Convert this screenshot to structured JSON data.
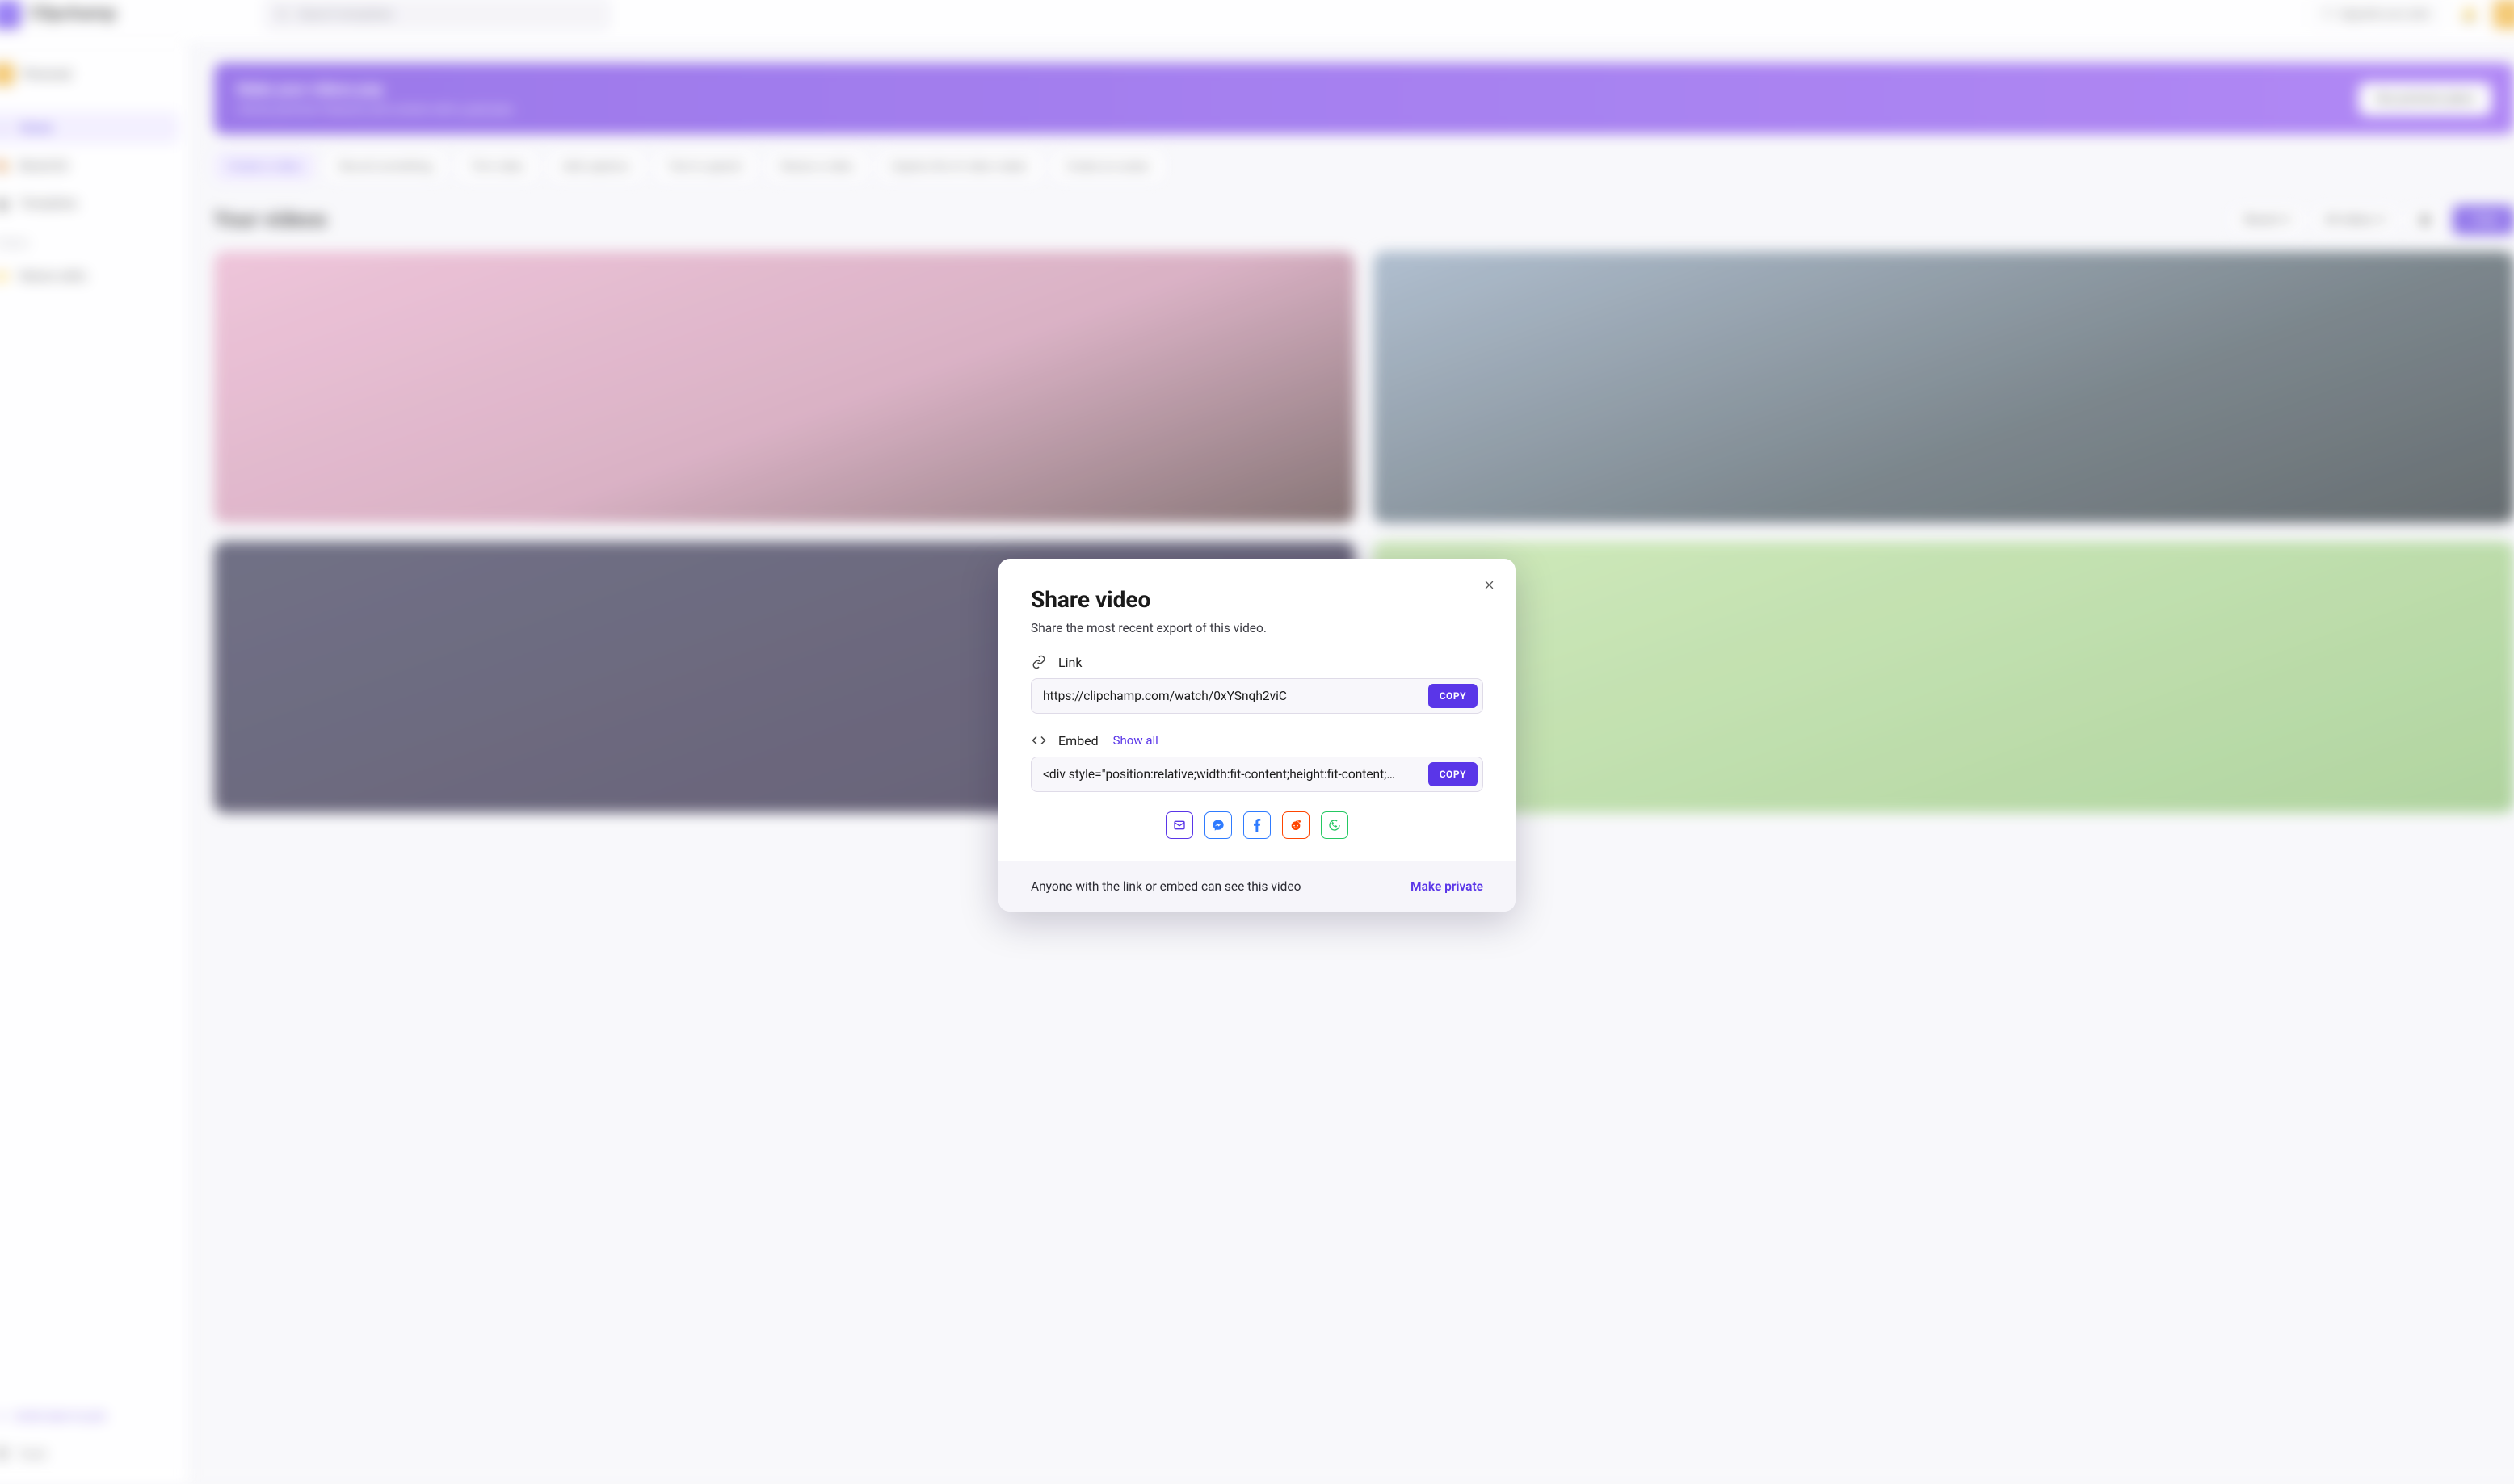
{
  "header": {
    "app_name": "Clipchamp",
    "search_placeholder": "Search templates",
    "upgrade_label": "Upgrade your plan"
  },
  "sidebar": {
    "workspace_name": "Personal",
    "items": [
      {
        "label": "Home",
        "icon": "home-icon",
        "active": true
      },
      {
        "label": "Brand kit",
        "icon": "palette-icon",
        "active": false
      },
      {
        "label": "Templates",
        "icon": "layout-icon",
        "active": false
      }
    ],
    "folders_label": "Folders",
    "folders": [
      {
        "label": "Nature edits"
      }
    ],
    "invite_label": "Invite team to join",
    "trash_label": "Trash"
  },
  "main": {
    "promo": {
      "title": "Make your videos pop",
      "subtitle": "Unlock premium features and content with a paid plan.",
      "cta": "See premium plans"
    },
    "chips": [
      "Create a video",
      "Record something",
      "Trim video",
      "Add captions",
      "Text to speech",
      "Resize a video",
      "Explore the AI video maker",
      "Create an avatar"
    ],
    "section_title": "Your videos",
    "sort_label": "Recent",
    "filter_label": "All videos",
    "new_btn": "+ New"
  },
  "modal": {
    "title": "Share video",
    "subtitle": "Share the most recent export of this video.",
    "link_label": "Link",
    "link_value": "https://clipchamp.com/watch/0xYSnqh2viC",
    "embed_label": "Embed",
    "embed_show_all": "Show all",
    "embed_value": "<div style=\"position:relative;width:fit-content;height:fit-content;…",
    "copy_label": "COPY",
    "share_targets": {
      "email": "email",
      "messenger": "messenger",
      "facebook": "facebook",
      "reddit": "reddit",
      "whatsapp": "whatsapp"
    },
    "footer_text": "Anyone with the link or embed can see this video",
    "make_private": "Make private"
  }
}
